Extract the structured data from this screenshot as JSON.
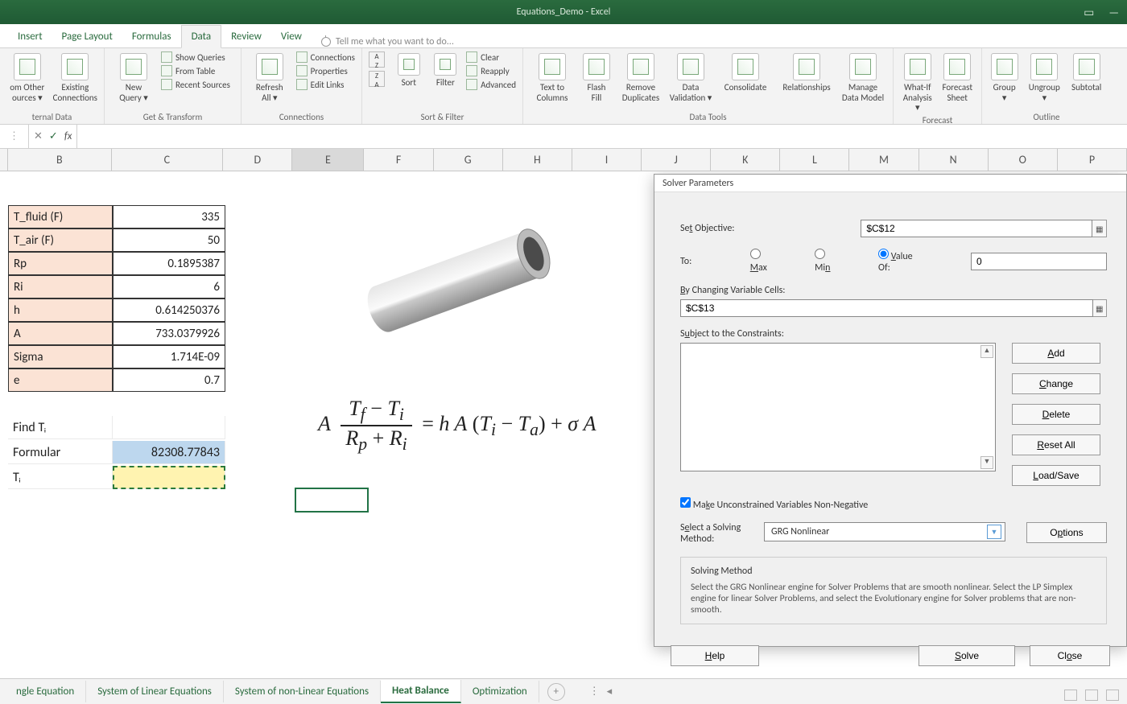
{
  "app_title": "Equations_Demo - Excel",
  "ribbon": {
    "tabs": [
      "Insert",
      "Page Layout",
      "Formulas",
      "Data",
      "Review",
      "View"
    ],
    "active_tab": "Data",
    "tell_me": "Tell me what you want to do...",
    "groups": {
      "external_data": {
        "label": "ternal Data",
        "btn1": "om Other\nources ▾",
        "btn2": "Existing\nConnections"
      },
      "get_transform": {
        "label": "Get & Transform",
        "btn": "New\nQuery ▾",
        "opts": [
          "Show Queries",
          "From Table",
          "Recent Sources"
        ]
      },
      "connections": {
        "label": "Connections",
        "btn": "Refresh\nAll ▾",
        "opts": [
          "Connections",
          "Properties",
          "Edit Links"
        ]
      },
      "sort_filter": {
        "label": "Sort & Filter",
        "sort_small": "A↓Z",
        "sort_small2": "Z↓A",
        "sort": "Sort",
        "filter": "Filter",
        "clear": "Clear",
        "reapply": "Reapply",
        "advanced": "Advanced"
      },
      "data_tools": {
        "label": "Data Tools",
        "b1": "Text to\nColumns",
        "b2": "Flash\nFill",
        "b3": "Remove\nDuplicates",
        "b4": "Data\nValidation ▾",
        "b5": "Consolidate",
        "b6": "Relationships",
        "b7": "Manage\nData Model"
      },
      "forecast": {
        "label": "Forecast",
        "b1": "What-If\nAnalysis ▾",
        "b2": "Forecast\nSheet"
      },
      "outline": {
        "label": "Outline",
        "b1": "Group\n▾",
        "b2": "Ungroup\n▾",
        "b3": "Subtotal"
      }
    }
  },
  "columns": [
    "B",
    "C",
    "D",
    "E",
    "F",
    "G",
    "H",
    "I",
    "J",
    "K",
    "L",
    "M",
    "N",
    "O",
    "P"
  ],
  "table": [
    {
      "label": "T_fluid (F)",
      "value": "335"
    },
    {
      "label": "T_air (F)",
      "value": "50"
    },
    {
      "label": "Rp",
      "value": "0.1895387"
    },
    {
      "label": "Ri",
      "value": "6"
    },
    {
      "label": "h",
      "value": "0.614250376"
    },
    {
      "label": "A",
      "value": "733.0379926"
    },
    {
      "label": "Sigma",
      "value": "1.714E-09"
    },
    {
      "label": "e",
      "value": "0.7"
    }
  ],
  "lower": {
    "find_label": "Find Tᵢ",
    "formula_label": "Formular",
    "formula_value": "82308.77843",
    "ti_label": "Tᵢ"
  },
  "equation": {
    "lhsA": "A",
    "num": "T_f − T_i",
    "den": "R_p + R_i",
    "eq": "= h A (T_i − T_a) + σ A"
  },
  "sheets": {
    "tabs": [
      "ngle Equation",
      "System of Linear Equations",
      "System of non-Linear Equations",
      "Heat Balance",
      "Optimization"
    ],
    "active": "Heat Balance"
  },
  "solver": {
    "title": "Solver Parameters",
    "set_objective": "Set Objective:",
    "objective_value": "$C$12",
    "to_label": "To:",
    "opt_max": "Max",
    "opt_min": "Min",
    "opt_valueof": "Value Of:",
    "value_of_box": "0",
    "by_changing": "By Changing Variable Cells:",
    "changing_value": "$C$13",
    "subject_to": "Subject to the Constraints:",
    "btn_add": "Add",
    "btn_change": "Change",
    "btn_delete": "Delete",
    "btn_reset": "Reset All",
    "btn_loadsave": "Load/Save",
    "make_unconstrained": "Make Unconstrained Variables Non-Negative",
    "select_method": "Select a Solving Method:",
    "method_value": "GRG Nonlinear",
    "btn_options": "Options",
    "solving_method_title": "Solving Method",
    "solving_method_text": "Select the GRG Nonlinear engine for Solver Problems that are smooth nonlinear. Select the LP Simplex engine for linear Solver Problems, and select the Evolutionary engine for Solver problems that are non-smooth.",
    "btn_help": "Help",
    "btn_solve": "Solve",
    "btn_close": "Close"
  }
}
